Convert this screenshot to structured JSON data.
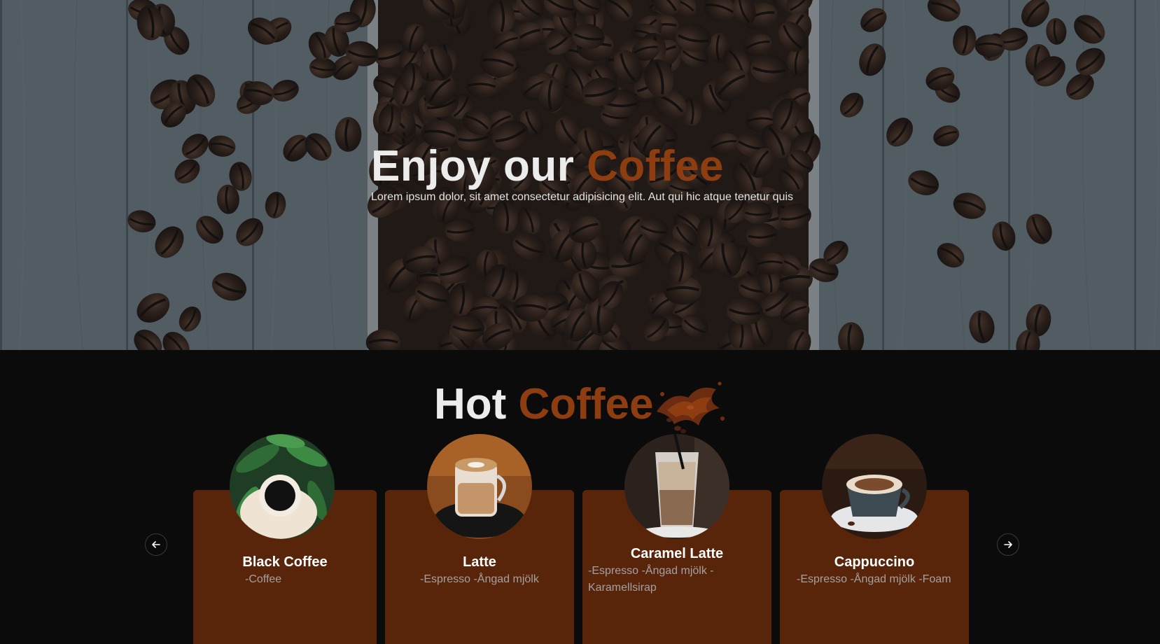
{
  "hero": {
    "title_main": "Enjoy our ",
    "title_accent": "Coffee",
    "subtitle": "Lorem ipsum dolor, sit amet consectetur adipisicing elit. Aut qui hic atque tenetur quis"
  },
  "menu_section": {
    "title_main": "Hot ",
    "title_accent": "Coffee",
    "prev_icon": "arrow-left-icon",
    "next_icon": "arrow-right-icon",
    "cards": [
      {
        "name": "Black Coffee",
        "description": "-Coffee"
      },
      {
        "name": "Latte",
        "description": "-Espresso -Ångad mjölk"
      },
      {
        "name": "Caramel Latte",
        "description": "-Espresso -Ångad mjölk -Karamellsirap"
      },
      {
        "name": "Cappuccino",
        "description": "-Espresso -Ångad mjölk -Foam"
      }
    ]
  },
  "colors": {
    "accent": "#8e3d11",
    "card_bg": "#58250b",
    "page_bg": "#0b0b0c"
  }
}
